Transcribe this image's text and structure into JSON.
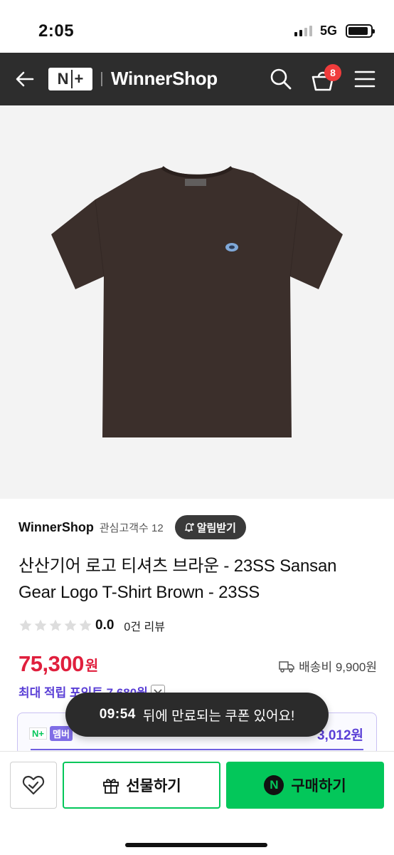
{
  "status_bar": {
    "time": "2:05",
    "network": "5G",
    "battery_level": 0.9
  },
  "header": {
    "logo_text": "N+",
    "title": "WinnerShop",
    "cart_count": "8",
    "icons": [
      "back-arrow-icon",
      "search-icon",
      "cart-icon",
      "menu-icon"
    ]
  },
  "product_image": {
    "alt": "brown t-shirt",
    "shirt_color": "#3b2f2b",
    "background": "#f3f3f3"
  },
  "shop": {
    "name": "WinnerShop",
    "followers": "관심고객수 12",
    "alarm_label": "알림받기"
  },
  "product": {
    "title": "산산기어 로고 티셔츠 브라운 - 23SS Sansan Gear Logo T-Shirt Brown - 23SS",
    "rating": "0.0",
    "reviews": "0건 리뷰",
    "price": "75,300",
    "price_unit": "원",
    "shipping": "배송비 9,900원",
    "points_label": "최대 적립 포인트 7,680원"
  },
  "membership": {
    "tag_np": "N+",
    "tag_label": "멤버",
    "amount": "3,012원"
  },
  "toast": {
    "time": "09:54",
    "message": "뒤에 만료되는 쿠폰 있어요!"
  },
  "bottom_bar": {
    "gift_label": "선물하기",
    "buy_label": "구매하기",
    "npay_letter": "N"
  },
  "colors": {
    "accent_green": "#03c75a",
    "price_red": "#e01f3d",
    "points_purple": "#5a3fd6",
    "header_bg": "#2d2d2d"
  }
}
